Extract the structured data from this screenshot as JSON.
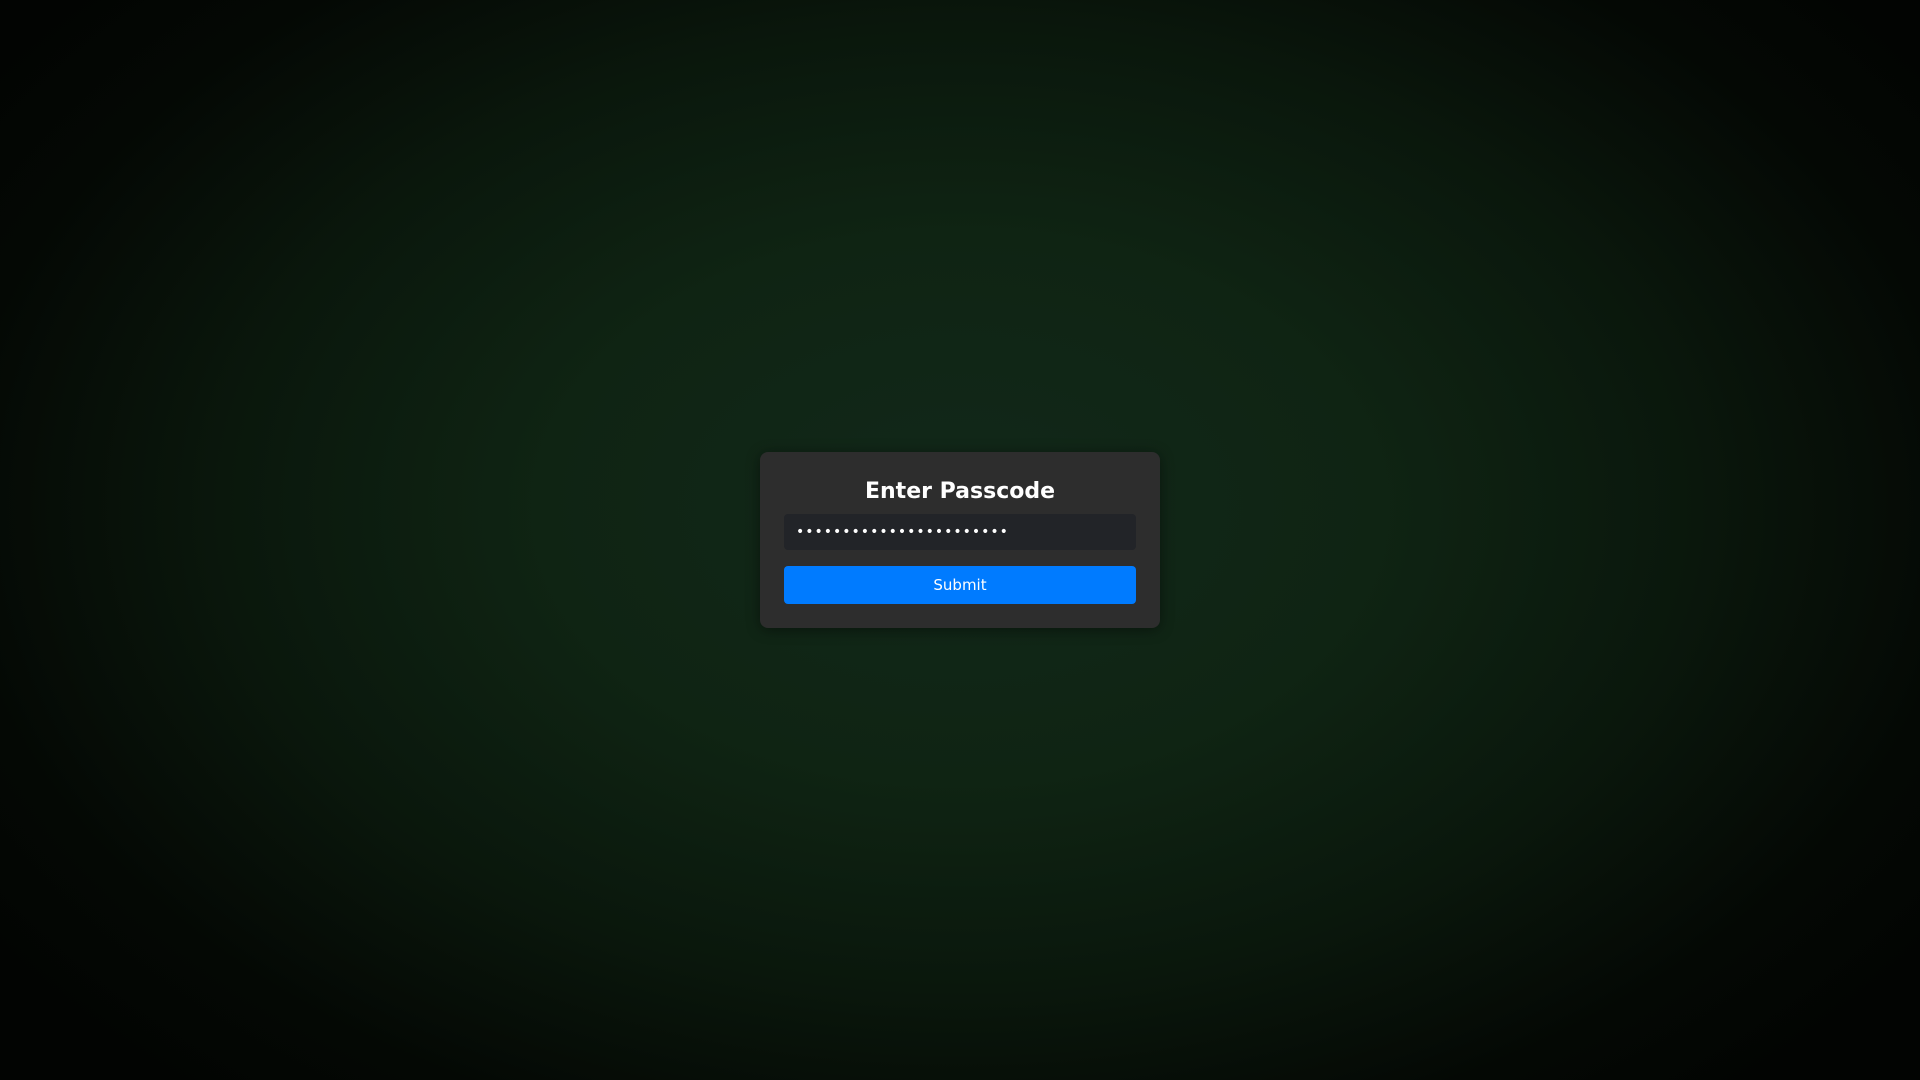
{
  "dialog": {
    "title": "Enter Passcode",
    "passcode_value": "passcode1234567890abcde",
    "submit_label": "Submit"
  },
  "colors": {
    "accent": "#007bff",
    "panel": "#2d2d2d",
    "input_bg": "#222428",
    "background_glow": "#12281a"
  }
}
